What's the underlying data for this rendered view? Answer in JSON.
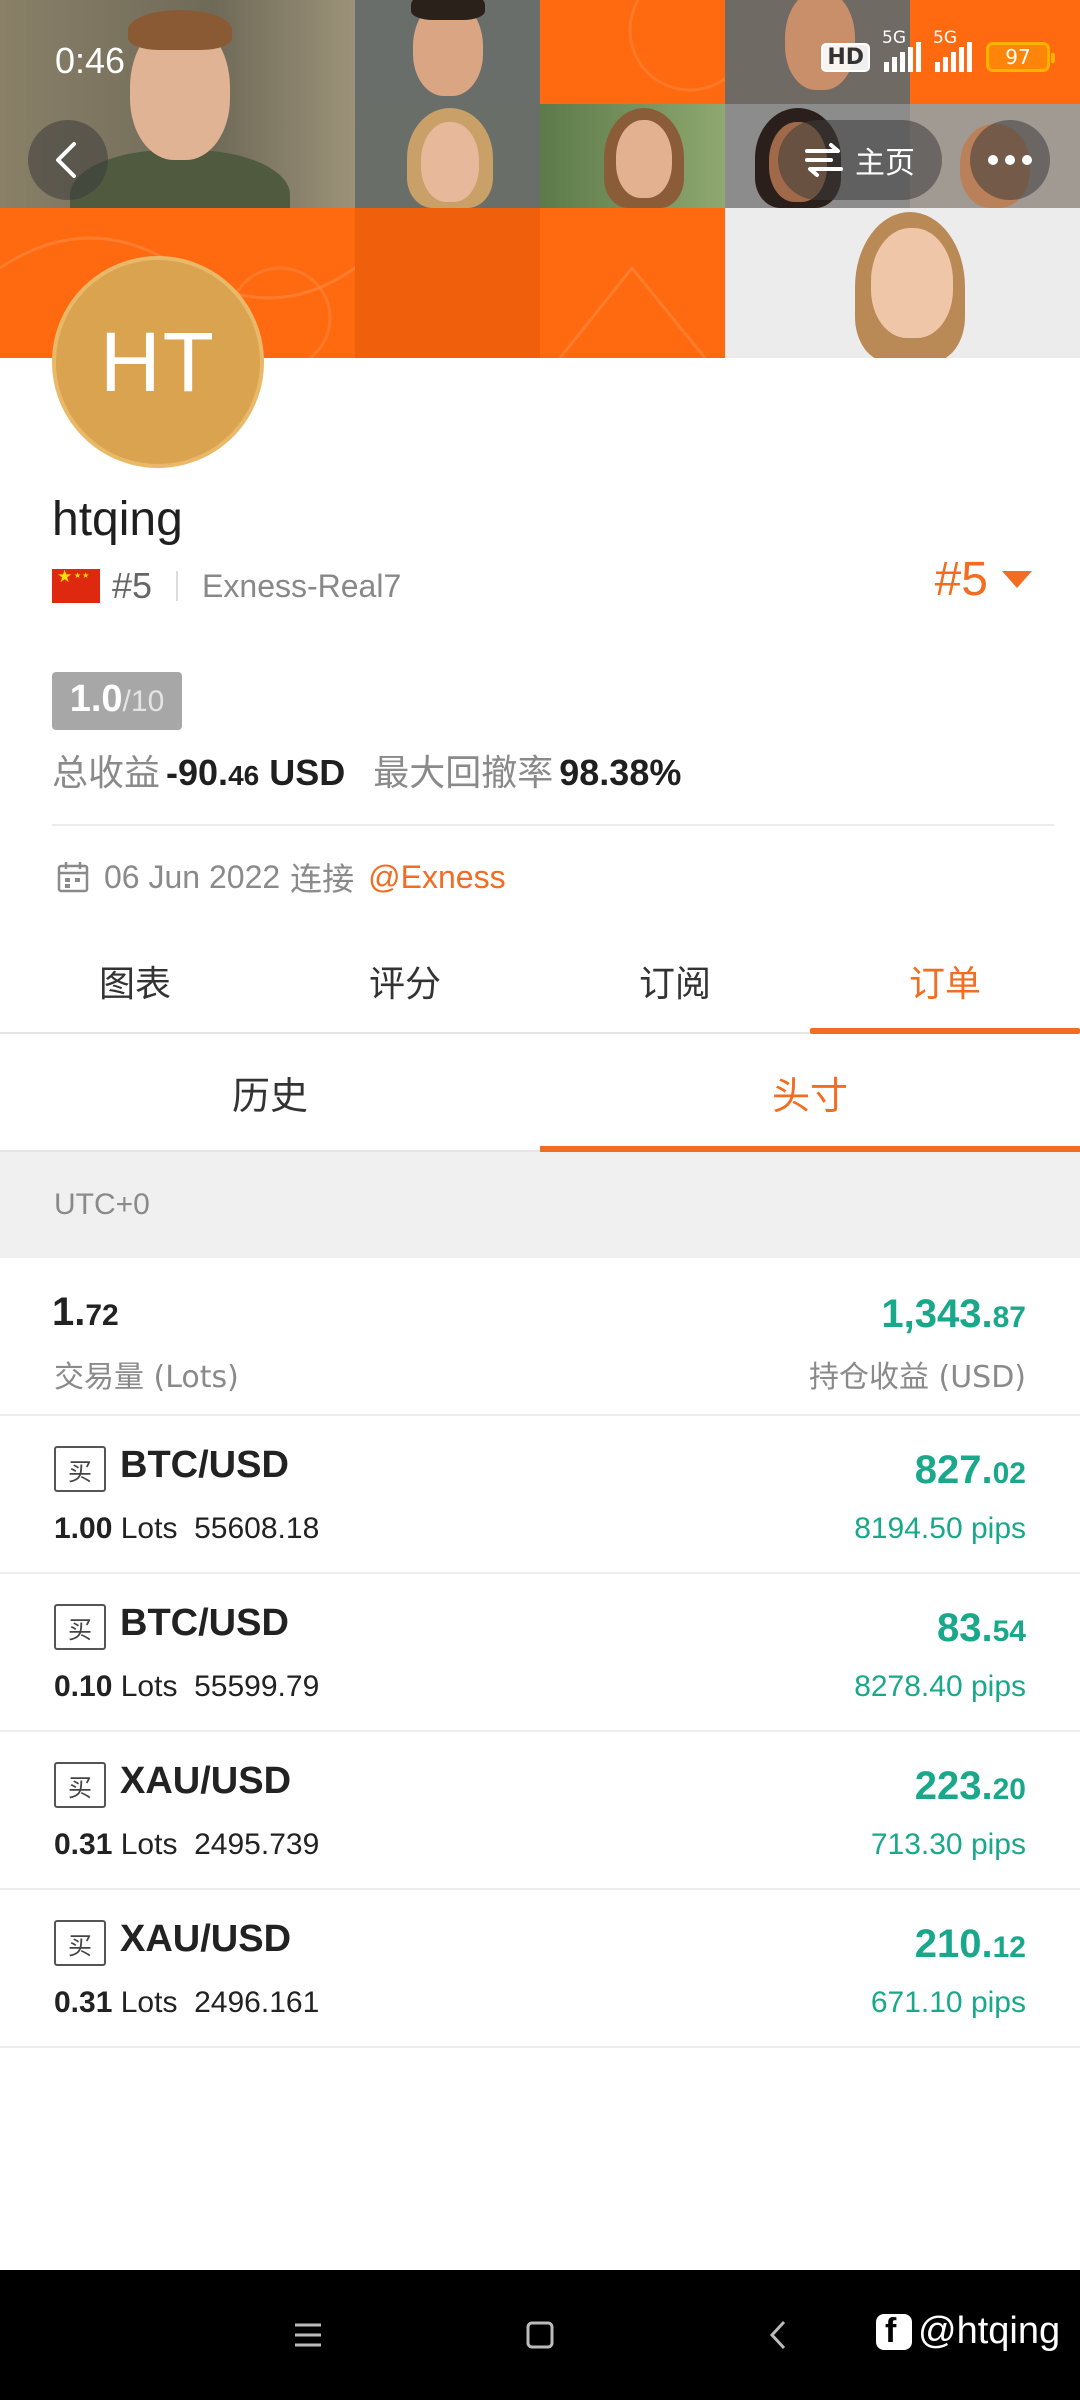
{
  "status_bar": {
    "time": "0:46",
    "hd_badge": "HD",
    "network_1": "5G",
    "network_2": "5G",
    "battery": "97"
  },
  "header": {
    "home_label": "主页",
    "back_icon": "chevron-left-icon",
    "more_icon": "more-dots-icon",
    "home_icon": "swap-arrows-icon"
  },
  "profile": {
    "avatar_initials": "HT",
    "username": "htqing",
    "country_flag": "china-flag-icon",
    "rank_small": "#5",
    "server": "Exness-Real7",
    "rank_big": "#5",
    "score": "1.0",
    "score_denominator": "/10",
    "total_profit_label": "总收益",
    "total_profit_int": "-90.",
    "total_profit_frac": "46",
    "total_profit_unit": " USD",
    "max_drawdown_label": "最大回撤率",
    "max_drawdown_value": "98.38%",
    "connect_date": "06 Jun 2022",
    "connect_word": "连接",
    "broker": "@Exness"
  },
  "main_tabs": [
    {
      "label": "图表",
      "active": false
    },
    {
      "label": "评分",
      "active": false
    },
    {
      "label": "订阅",
      "active": false
    },
    {
      "label": "订单",
      "active": true
    }
  ],
  "sub_tabs": [
    {
      "label": "历史",
      "active": false
    },
    {
      "label": "头寸",
      "active": true
    }
  ],
  "timezone": "UTC+0",
  "summary": {
    "volume_int": "1.",
    "volume_frac": "72",
    "volume_label": "交易量 (Lots)",
    "profit_int": "1,343.",
    "profit_frac": "87",
    "profit_label": "持仓收益 (USD)"
  },
  "positions": [
    {
      "side": "买",
      "symbol": "BTC/USD",
      "lots": "1.00",
      "lots_unit": "Lots",
      "price": "55608.18",
      "profit_int": "827.",
      "profit_frac": "02",
      "pips": "8194.50 pips"
    },
    {
      "side": "买",
      "symbol": "BTC/USD",
      "lots": "0.10",
      "lots_unit": "Lots",
      "price": "55599.79",
      "profit_int": "83.",
      "profit_frac": "54",
      "pips": "8278.40 pips"
    },
    {
      "side": "买",
      "symbol": "XAU/USD",
      "lots": "0.31",
      "lots_unit": "Lots",
      "price": "2495.739",
      "profit_int": "223.",
      "profit_frac": "20",
      "pips": "713.30 pips"
    },
    {
      "side": "买",
      "symbol": "XAU/USD",
      "lots": "0.31",
      "lots_unit": "Lots",
      "price": "2496.161",
      "profit_int": "210.",
      "profit_frac": "12",
      "pips": "671.10 pips"
    }
  ],
  "watermark": "@htqing",
  "colors": {
    "accent": "#f26d21",
    "profit_green": "#1aa88a",
    "avatar_bg": "#d9a34f",
    "banner_orange": "#ff6a10"
  }
}
